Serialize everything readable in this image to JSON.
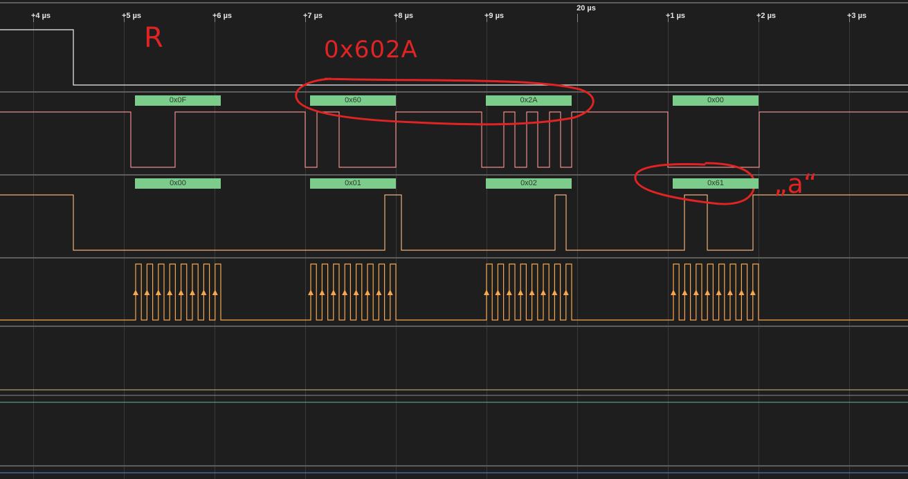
{
  "ruler": {
    "ticks": [
      "+4 µs",
      "+5 µs",
      "+6 µs",
      "+7 µs",
      "+8 µs",
      "+9 µs",
      "+1 µs",
      "+2 µs",
      "+3 µs"
    ],
    "reference": "20 µs"
  },
  "decoders": {
    "row1": [
      "0x0F",
      "0x60",
      "0x2A",
      "0x00"
    ],
    "row2": [
      "0x00",
      "0x01",
      "0x02",
      "0x61"
    ]
  },
  "annotations": {
    "r_note": "R",
    "hex_note": "0x602A",
    "char_note": "„a“"
  },
  "colors": {
    "background": "#1e1e1e",
    "grid": "#3a3a3a",
    "separator": "#6a6a6a",
    "channel0": "#f2f2f2",
    "channel1": "#ef8c8c",
    "channel2": "#f0b07a",
    "channel3": "#f7a84f",
    "decode": "#7ccd8c",
    "annotation": "#e02424"
  }
}
